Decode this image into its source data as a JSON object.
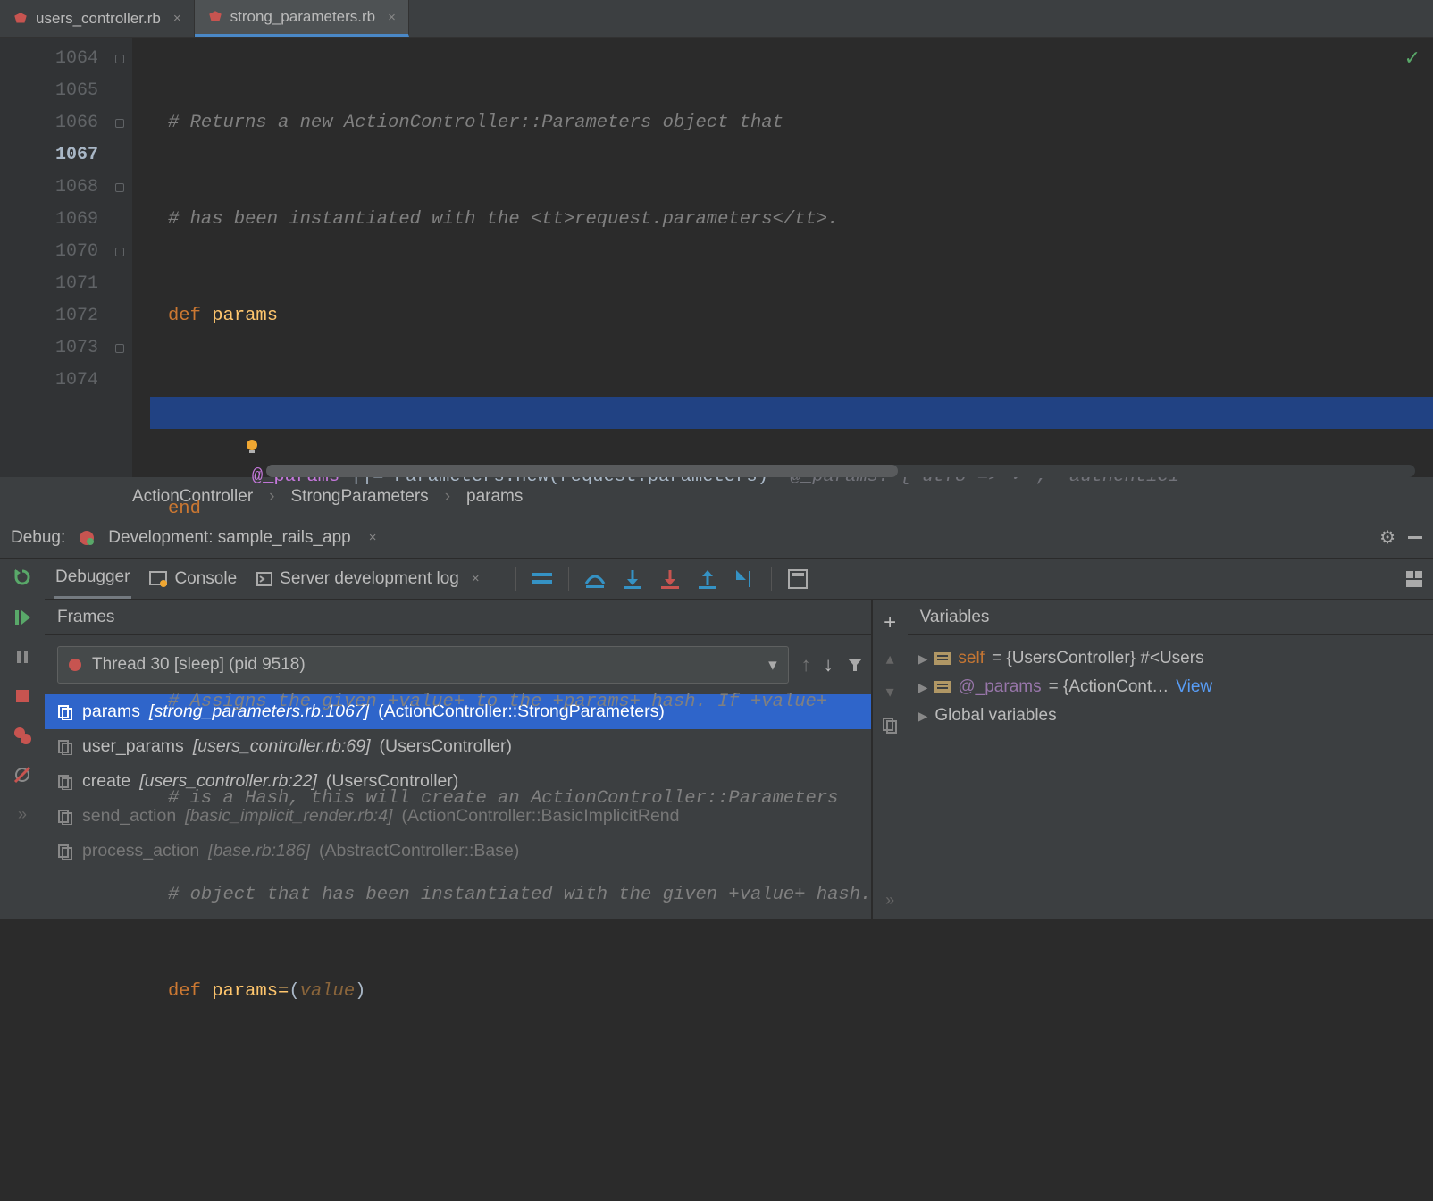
{
  "tabs": [
    {
      "label": "users_controller.rb",
      "active": false
    },
    {
      "label": "strong_parameters.rb",
      "active": true
    }
  ],
  "gutter": {
    "start": 1064,
    "active": 1067,
    "count": 11
  },
  "code": {
    "l1064": "# Returns a new ActionController::Parameters object that",
    "l1065": "# has been instantiated with the <tt>request.parameters</tt>.",
    "l1066_def": "def",
    "l1066_name": "params",
    "l1067_ivar": "@_params",
    "l1067_op": " ||= ",
    "l1067_call": "Parameters.new(request.parameters)",
    "l1067_hint": "  @_params: {\"utf8\"=>\"✓\", \"authentici",
    "l1068": "end",
    "l1070": "# Assigns the given +value+ to the +params+ hash. If +value+",
    "l1071": "# is a Hash, this will create an ActionController::Parameters",
    "l1072": "# object that has been instantiated with the given +value+ hash.",
    "l1073_def": "def",
    "l1073_name": "params=",
    "l1073_lp": "(",
    "l1073_arg": "value",
    "l1073_rp": ")"
  },
  "breadcrumb": [
    "ActionController",
    "StrongParameters",
    "params"
  ],
  "debug": {
    "label": "Debug:",
    "config": "Development: sample_rails_app",
    "tabs": {
      "debugger": "Debugger",
      "console": "Console",
      "serverlog": "Server development log"
    },
    "frames_header": "Frames",
    "vars_header": "Variables",
    "thread": "Thread 30 [sleep] (pid 9518)",
    "frames": [
      {
        "name": "params",
        "loc": "[strong_parameters.rb:1067]",
        "ctx": "(ActionController::StrongParameters)",
        "sel": true,
        "dim": false
      },
      {
        "name": "user_params",
        "loc": "[users_controller.rb:69]",
        "ctx": "(UsersController)",
        "sel": false,
        "dim": false
      },
      {
        "name": "create",
        "loc": "[users_controller.rb:22]",
        "ctx": "(UsersController)",
        "sel": false,
        "dim": false
      },
      {
        "name": "send_action",
        "loc": "[basic_implicit_render.rb:4]",
        "ctx": "(ActionController::BasicImplicitRend",
        "sel": false,
        "dim": true
      },
      {
        "name": "process_action",
        "loc": "[base.rb:186]",
        "ctx": "(AbstractController::Base)",
        "sel": false,
        "dim": true
      }
    ],
    "variables": {
      "self_name": "self",
      "self_val": " = {UsersController} #<Users",
      "params_name": "@_params",
      "params_val": " = {ActionCont…",
      "view_link": " View",
      "globals": "Global variables"
    }
  }
}
